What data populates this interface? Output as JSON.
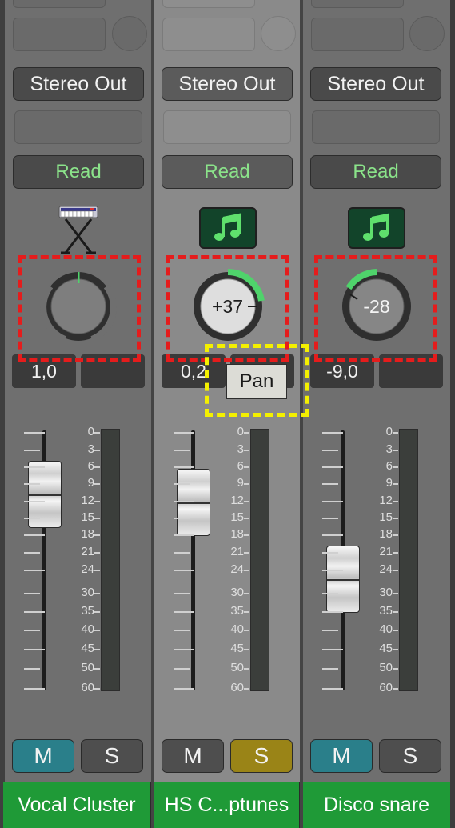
{
  "channels": [
    {
      "id": "ch1",
      "output": "Stereo Out",
      "automation": "Read",
      "icon": "keyboard-stand-icon",
      "pan": {
        "value": 0,
        "label": ""
      },
      "volume_readout": "1,0",
      "secondary_readout": "",
      "fader_level_db": -12,
      "mute_label": "M",
      "solo_label": "S",
      "mute_active": true,
      "solo_active": false,
      "name": "Vocal Cluster"
    },
    {
      "id": "ch2",
      "output": "Stereo Out",
      "automation": "Read",
      "icon": "music-note-icon",
      "pan": {
        "value": 37,
        "label": "+37"
      },
      "volume_readout": "0,2",
      "secondary_readout": "",
      "fader_level_db": -13,
      "mute_label": "M",
      "solo_label": "S",
      "mute_active": false,
      "solo_active": true,
      "name": "HS C...ptunes"
    },
    {
      "id": "ch3",
      "output": "Stereo Out",
      "automation": "Read",
      "icon": "music-note-icon",
      "pan": {
        "value": -28,
        "label": "-28"
      },
      "volume_readout": "-9,0",
      "secondary_readout": "",
      "fader_level_db": -28,
      "mute_label": "M",
      "solo_label": "S",
      "mute_active": true,
      "solo_active": false,
      "name": "Disco snare"
    }
  ],
  "scale_labels": [
    "0",
    "3",
    "6",
    "9",
    "12",
    "15",
    "18",
    "21",
    "24",
    "30",
    "35",
    "40",
    "45",
    "50",
    "60"
  ],
  "tooltip": {
    "label": "Pan"
  },
  "colors": {
    "read_text": "#8be38a",
    "mute_active": "#2a7f8a",
    "solo_active": "#9a8417",
    "name_bar": "#1f9a37",
    "pan_arc": "#4fd36b",
    "annotation_red": "#e51c1c",
    "annotation_yellow": "#f4f000"
  }
}
